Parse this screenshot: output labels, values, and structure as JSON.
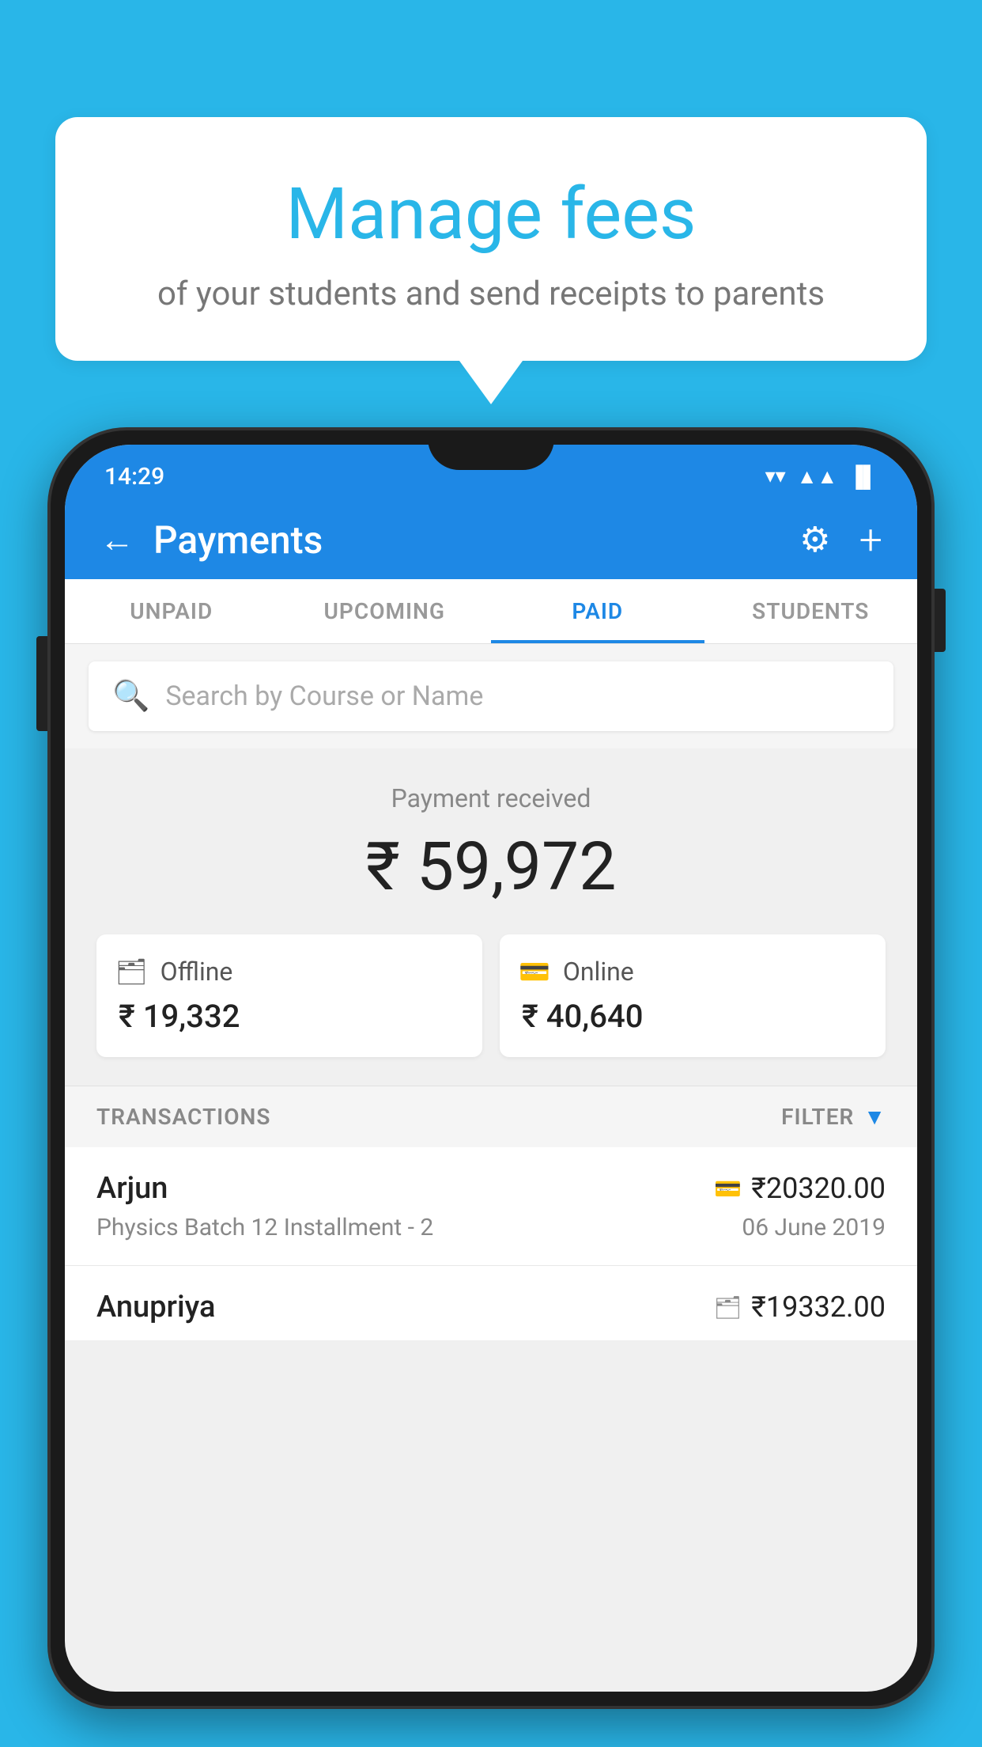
{
  "background_color": "#29b6e8",
  "speech_bubble": {
    "title": "Manage fees",
    "subtitle": "of your students and send receipts to parents"
  },
  "status_bar": {
    "time": "14:29",
    "wifi": "▼",
    "signal": "▲",
    "battery": "▐"
  },
  "header": {
    "title": "Payments",
    "back_label": "←",
    "gear_label": "⚙",
    "plus_label": "+"
  },
  "tabs": [
    {
      "label": "UNPAID",
      "active": false
    },
    {
      "label": "UPCOMING",
      "active": false
    },
    {
      "label": "PAID",
      "active": true
    },
    {
      "label": "STUDENTS",
      "active": false
    }
  ],
  "search": {
    "placeholder": "Search by Course or Name"
  },
  "payment_summary": {
    "label": "Payment received",
    "amount": "₹ 59,972",
    "offline": {
      "label": "Offline",
      "amount": "₹ 19,332"
    },
    "online": {
      "label": "Online",
      "amount": "₹ 40,640"
    }
  },
  "transactions_section": {
    "label": "TRANSACTIONS",
    "filter_label": "FILTER"
  },
  "transactions": [
    {
      "name": "Arjun",
      "course": "Physics Batch 12 Installment - 2",
      "amount": "₹20320.00",
      "date": "06 June 2019",
      "payment_type": "card"
    },
    {
      "name": "Anupriya",
      "course": "",
      "amount": "₹19332.00",
      "date": "",
      "payment_type": "offline"
    }
  ]
}
